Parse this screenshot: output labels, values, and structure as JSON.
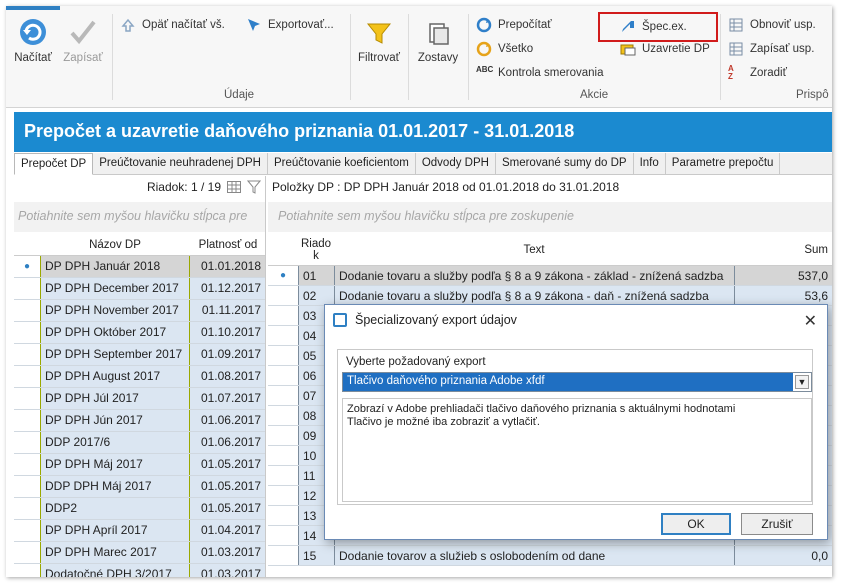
{
  "ribbon": {
    "udaje": {
      "group_label": "Údaje",
      "nacitat": "Načítať",
      "zapisat": "Zapísať",
      "opat_nacitat": "Opäť načítať vš.",
      "exportovat": "Exportovať..."
    },
    "filtrovat": "Filtrovať",
    "zostavy": "Zostavy",
    "akcie": {
      "group_label": "Akcie",
      "prepocitat": "Prepočítať",
      "vsetko": "Všetko",
      "kontrola": "Kontrola smerovania",
      "spec_ex": "Špec.ex.",
      "uzavretie": "Uzavretie DP"
    },
    "right": {
      "group_label": "Prispô",
      "obnovit": "Obnoviť usp.",
      "zapisat_usp": "Zapísať usp.",
      "zoradit": "Zoradiť"
    }
  },
  "title": "Prepočet a uzavretie daňového priznania 01.01.2017 - 31.01.2018",
  "tabs": [
    "Prepočet DP",
    "Preúčtovanie neuhradenej DPH",
    "Preúčtovanie koeficientom",
    "Odvody DPH",
    "Smerované sumy do DP",
    "Info",
    "Parametre prepočtu"
  ],
  "left": {
    "rowcount": "Riadok: 1 / 19",
    "grouping_hint": "Potiahnite sem myšou hlavičku stĺpca pre",
    "col_name": "Názov DP",
    "col_valid": "Platnosť od",
    "rows": [
      {
        "name": "DP DPH Január 2018",
        "date": "01.01.2018"
      },
      {
        "name": "DP DPH December 2017",
        "date": "01.12.2017"
      },
      {
        "name": "DP DPH November 2017",
        "date": "01.11.2017"
      },
      {
        "name": "DP DPH Október 2017",
        "date": "01.10.2017"
      },
      {
        "name": "DP DPH September 2017",
        "date": "01.09.2017"
      },
      {
        "name": "DP DPH August 2017",
        "date": "01.08.2017"
      },
      {
        "name": "DP DPH Júl 2017",
        "date": "01.07.2017"
      },
      {
        "name": "DP DPH Jún 2017",
        "date": "01.06.2017"
      },
      {
        "name": "DDP 2017/6",
        "date": "01.06.2017"
      },
      {
        "name": "DP DPH Máj 2017",
        "date": "01.05.2017"
      },
      {
        "name": "DDP DPH Máj 2017",
        "date": "01.05.2017"
      },
      {
        "name": "DDP2",
        "date": "01.05.2017"
      },
      {
        "name": "DP DPH Apríl 2017",
        "date": "01.04.2017"
      },
      {
        "name": "DP DPH Marec 2017",
        "date": "01.03.2017"
      },
      {
        "name": "Dodatočné DPH 3/2017",
        "date": "01.03.2017"
      }
    ]
  },
  "right": {
    "polozky": "Položky DP  : DP DPH Január 2018 od 01.01.2018 do 31.01.2018",
    "grouping_hint": "Potiahnite sem myšou hlavičku stĺpca pre zoskupenie",
    "col_riadok": "Riado k",
    "col_text": "Text",
    "col_suma": "Sum",
    "rows": [
      {
        "no": "01",
        "text": "Dodanie tovaru a služby podľa § 8 a 9 zákona - základ - znížená sadzba",
        "sum": "537,0"
      },
      {
        "no": "02",
        "text": "Dodanie tovaru a služby podľa § 8 a 9 zákona - daň - znížená sadzba",
        "sum": "53,6"
      },
      {
        "no": "03",
        "text": "",
        "sum": ""
      },
      {
        "no": "04",
        "text": "",
        "sum": ""
      },
      {
        "no": "05",
        "text": "",
        "sum": ""
      },
      {
        "no": "06",
        "text": "",
        "sum": ""
      },
      {
        "no": "07",
        "text": "",
        "sum": ""
      },
      {
        "no": "08",
        "text": "",
        "sum": ""
      },
      {
        "no": "09",
        "text": "",
        "sum": ""
      },
      {
        "no": "10",
        "text": "",
        "sum": ""
      },
      {
        "no": "11",
        "text": "",
        "sum": ""
      },
      {
        "no": "12",
        "text": "",
        "sum": ""
      },
      {
        "no": "13",
        "text": "",
        "sum": ""
      },
      {
        "no": "14",
        "text": "",
        "sum": ""
      },
      {
        "no": "15",
        "text": "Dodanie tovarov a služieb s oslobodením od dane",
        "sum": "0,0"
      }
    ]
  },
  "dialog": {
    "title": "Špecializovaný export údajov",
    "label": "Vyberte požadovaný export",
    "selected": "Tlačivo daňového priznania Adobe xfdf",
    "desc_line1": "Zobrazí v Adobe prehliadači tlačivo daňového priznania s aktuálnymi hodnotami",
    "desc_line2": "Tlačivo je možné iba zobraziť a vytlačiť.",
    "ok": "OK",
    "cancel": "Zrušiť"
  },
  "colors": {
    "title_bg": "#1b8ad0",
    "selection_blue": "#1f6fc2",
    "highlight_red": "#d11b1b",
    "row_bg": "#dbe6f2"
  }
}
